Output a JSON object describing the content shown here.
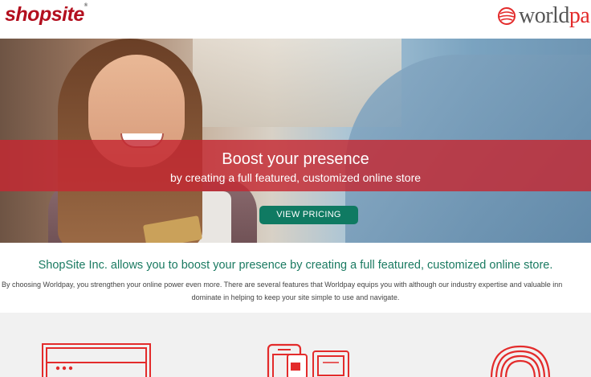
{
  "header": {
    "shopsite_logo": "shopsite",
    "shopsite_tm": "®",
    "worldpay_logo_main": "world",
    "worldpay_logo_tail": "pa"
  },
  "hero": {
    "headline": "Boost your presence",
    "subheadline": "by creating a full featured, customized online store",
    "cta_label": "VIEW PRICING"
  },
  "intro": {
    "title": "ShopSite Inc. allows you to boost your presence by creating a full featured, customized online store.",
    "line1": "By choosing Worldpay, you strengthen your online power even more. There are several features that Worldpay equips you with although our industry expertise and valuable inn",
    "line2": "dominate in helping to keep your site simple to use and navigate."
  },
  "features": {
    "icons": [
      "browser-window-icon",
      "multi-device-icon",
      "stacked-cards-icon"
    ]
  },
  "colors": {
    "brand_red": "#b3101f",
    "banner_red": "#c42832",
    "accent_green": "#0f7a62",
    "title_green": "#1a7a61",
    "feature_bg": "#f1f1f1"
  }
}
